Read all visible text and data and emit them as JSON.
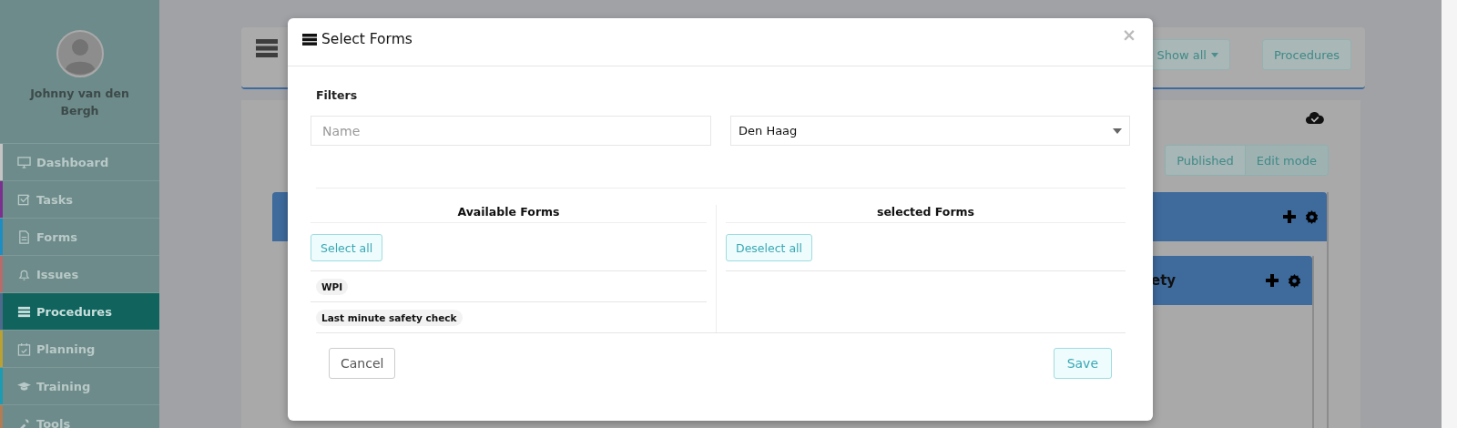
{
  "sidebar": {
    "user_name": "Johnny van den Bergh",
    "items": [
      {
        "label": "Dashboard",
        "color": "#c4c4c4",
        "selected": false
      },
      {
        "label": "Tasks",
        "color": "#7b2f8e",
        "selected": false
      },
      {
        "label": "Forms",
        "color": "#1e8dc2",
        "selected": false
      },
      {
        "label": "Issues",
        "color": "#b86b6b",
        "selected": false
      },
      {
        "label": "Procedures",
        "color": "#4d6a8c",
        "selected": true
      },
      {
        "label": "Planning",
        "color": "#b9a233",
        "selected": false
      },
      {
        "label": "Training",
        "color": "#1c9bb3",
        "selected": false
      },
      {
        "label": "Tools",
        "color": "#b27d55",
        "selected": false
      }
    ]
  },
  "header": {
    "filter_button": "Show all",
    "procedures_button": "Procedures"
  },
  "mode_toggle": [
    {
      "label": "Published",
      "selected": false
    },
    {
      "label": "Edit mode",
      "selected": true
    }
  ],
  "inner_panel": {
    "title": "ety"
  },
  "modal": {
    "title": "Select Forms",
    "close": "×",
    "filters_label": "Filters",
    "name_field": {
      "placeholder": "Name"
    },
    "location_select": {
      "value": "Den Haag"
    },
    "available": {
      "title": "Available Forms",
      "button": "Select all",
      "items": [
        "WPI",
        "Last minute safety check"
      ]
    },
    "selected": {
      "title": "selected Forms",
      "button": "Deselect all"
    },
    "cancel": "Cancel",
    "save": "Save"
  }
}
